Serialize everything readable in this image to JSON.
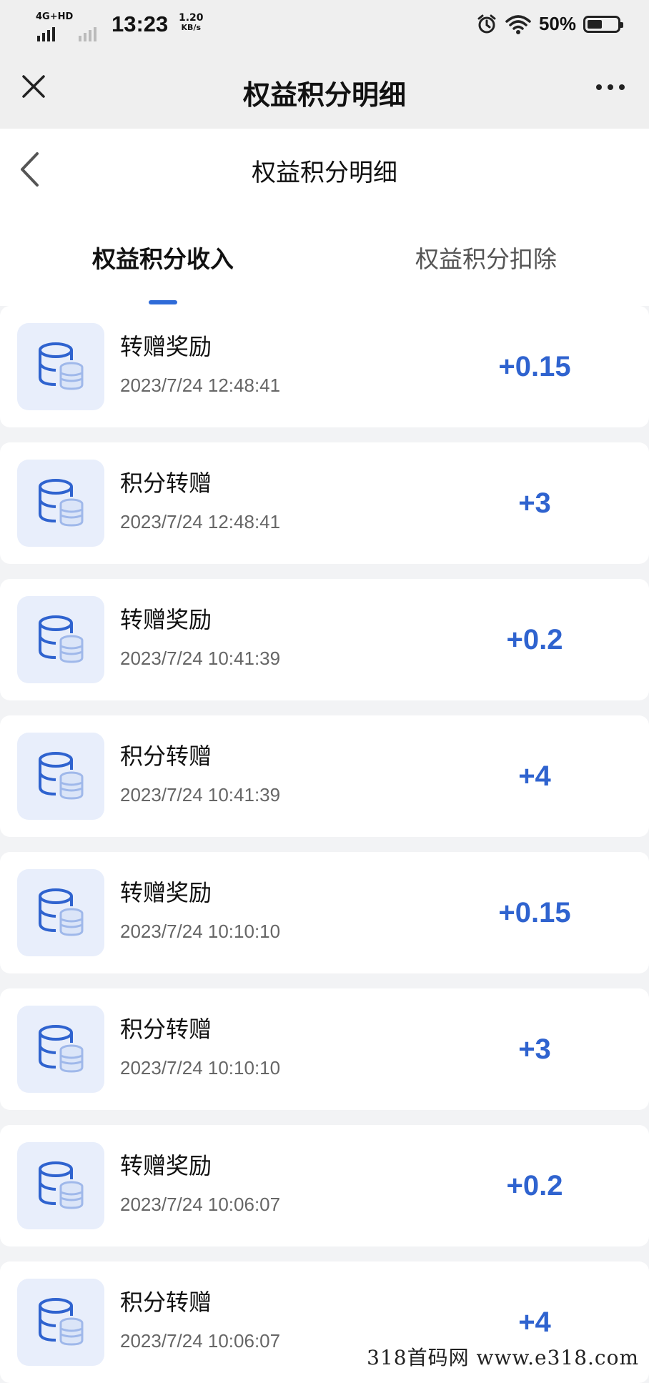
{
  "status_bar": {
    "network": "4G+HD",
    "time": "13:23",
    "speed_value": "1.20",
    "speed_unit": "KB/s",
    "battery_percent": "50%",
    "battery_level": 0.5,
    "icons": [
      "signal-icon",
      "alarm-icon",
      "wifi-icon",
      "battery-icon"
    ]
  },
  "top_nav": {
    "title": "权益积分明细",
    "close_icon": "close-icon",
    "more_icon": "more-icon"
  },
  "page_header": {
    "title": "权益积分明细",
    "back_icon": "chevron-left-icon"
  },
  "tabs": [
    {
      "label": "权益积分收入",
      "active": true
    },
    {
      "label": "权益积分扣除",
      "active": false
    }
  ],
  "accent_color": "#2f63cf",
  "items": [
    {
      "title": "转赠奖励",
      "time": "2023/7/24 12:48:41",
      "amount": "+0.15"
    },
    {
      "title": "积分转赠",
      "time": "2023/7/24 12:48:41",
      "amount": "+3"
    },
    {
      "title": "转赠奖励",
      "time": "2023/7/24 10:41:39",
      "amount": "+0.2"
    },
    {
      "title": "积分转赠",
      "time": "2023/7/24 10:41:39",
      "amount": "+4"
    },
    {
      "title": "转赠奖励",
      "time": "2023/7/24 10:10:10",
      "amount": "+0.15"
    },
    {
      "title": "积分转赠",
      "time": "2023/7/24 10:10:10",
      "amount": "+3"
    },
    {
      "title": "转赠奖励",
      "time": "2023/7/24 10:06:07",
      "amount": "+0.2"
    },
    {
      "title": "积分转赠",
      "time": "2023/7/24 10:06:07",
      "amount": "+4"
    }
  ],
  "watermark": "318首码网 www.e318.com"
}
